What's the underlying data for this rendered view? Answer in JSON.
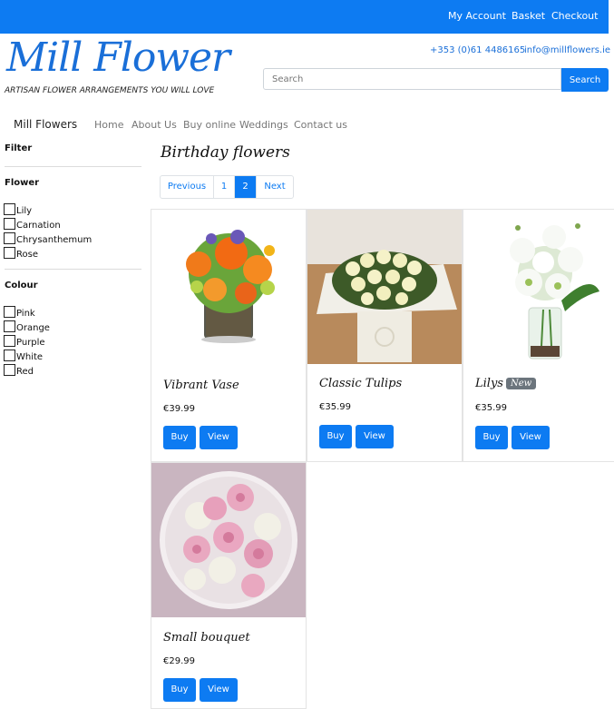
{
  "topbar": {
    "links": [
      "My Account",
      "Basket",
      "Checkout"
    ],
    "color": "#0d7bf2"
  },
  "header": {
    "logo": "Mill Flower",
    "tagline": "ARTISAN FLOWER ARRANGEMENTS YOU WILL LOVE",
    "phone": "+353 (0)61 4486165",
    "email": "info@millflowers.ie",
    "search": {
      "placeholder": "Search",
      "button": "Search"
    }
  },
  "nav": {
    "brand": "Mill Flowers",
    "links": [
      "Home",
      "About Us",
      "Buy online",
      "Weddings",
      "Contact us"
    ]
  },
  "sidebar": {
    "title": "Filter",
    "flower_title": "Flower",
    "flowers": [
      "Lily",
      "Carnation",
      "Chrysanthemum",
      "Rose"
    ],
    "colour_title": "Colour",
    "colours": [
      "Pink",
      "Orange",
      "Purple",
      "White",
      "Red"
    ]
  },
  "main": {
    "title": "Birthday flowers",
    "pagination": {
      "previous": "Previous",
      "pages": [
        "1",
        "2"
      ],
      "active": "2",
      "next": "Next"
    },
    "products": [
      {
        "name": "Vibrant Vase",
        "price": "€39.99",
        "buy": "Buy",
        "view": "View",
        "image": "orange-flower-vase"
      },
      {
        "name": "Classic Tulips",
        "price": "€35.99",
        "buy": "Buy",
        "view": "View",
        "image": "white-tulip-box"
      },
      {
        "name": "Lilys",
        "badge": "New",
        "price": "€35.99",
        "buy": "Buy",
        "view": "View",
        "image": "white-lily-vase"
      },
      {
        "name": "Small bouquet",
        "price": "€29.99",
        "buy": "Buy",
        "view": "View",
        "image": "pink-rose-bouquet"
      }
    ]
  }
}
